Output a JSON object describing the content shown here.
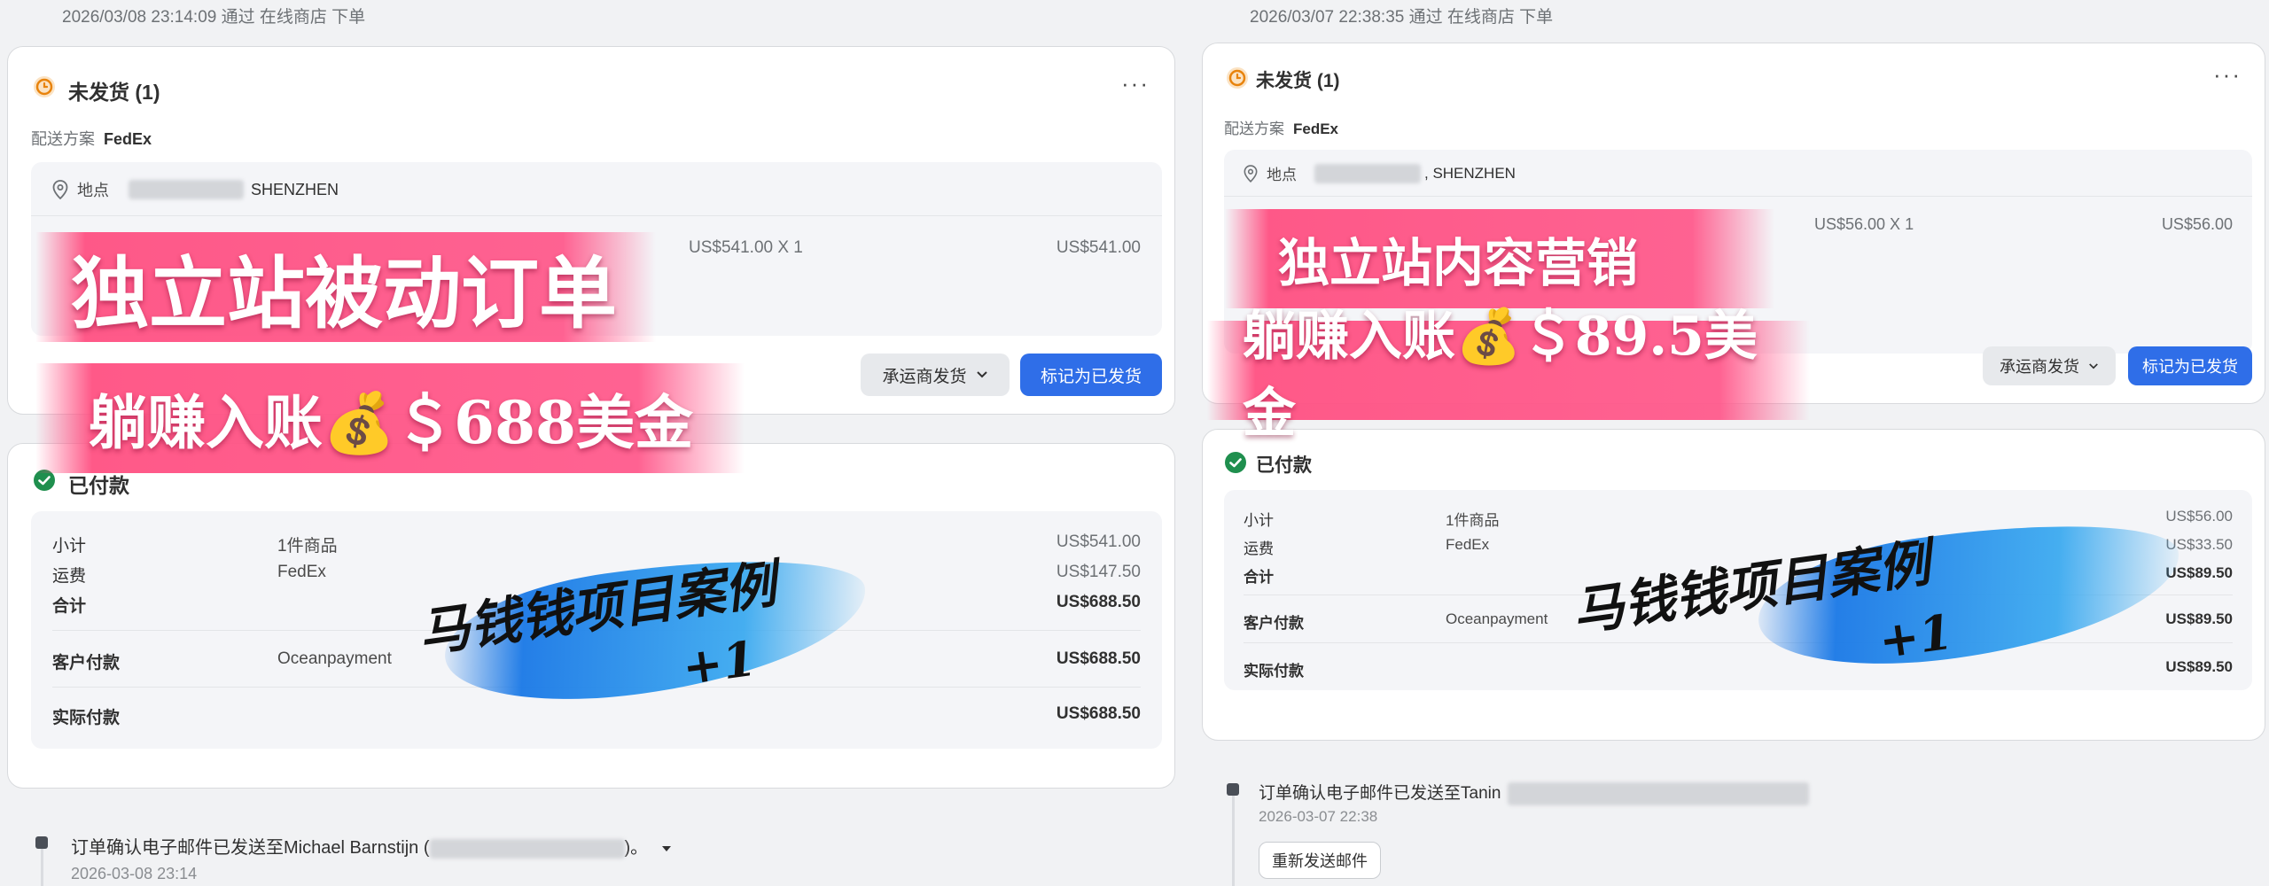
{
  "left": {
    "header": "2026/03/08 23:14:09 通过 在线商店 下单",
    "fulfill": {
      "title": "未发货 (1)",
      "ship_label": "配送方案",
      "ship_value": "FedEx",
      "loc_label": "地点",
      "loc_value": "SHENZHEN",
      "item_price": "US$541.00 X 1",
      "item_total": "US$541.00",
      "carrier_btn": "承运商发货",
      "mark_btn": "标记为已发货"
    },
    "paid": {
      "title": "已付款",
      "rows": [
        {
          "label": "小计",
          "mid": "1件商品",
          "value": "US$541.00"
        },
        {
          "label": "运费",
          "mid": "FedEx",
          "value": "US$147.50"
        },
        {
          "label": "合计",
          "mid": "",
          "value": "US$688.50"
        },
        {
          "label": "客户付款",
          "mid": "Oceanpayment",
          "value": "US$688.50"
        },
        {
          "label": "实际付款",
          "mid": "",
          "value": "US$688.50"
        }
      ]
    },
    "timeline": {
      "text": "订单确认电子邮件已发送至Michael Barnstijn (",
      "suffix": ")。",
      "time": "2026-03-08 23:14"
    },
    "overlay": {
      "banner1": "独立站被动订单",
      "banner2": "躺赚入账💰＄688美金",
      "brush_line1": "马钱钱项目案例",
      "brush_line2": "+1"
    }
  },
  "right": {
    "header": "2026/03/07 22:38:35 通过 在线商店 下单",
    "fulfill": {
      "title": "未发货 (1)",
      "ship_label": "配送方案",
      "ship_value": "FedEx",
      "loc_label": "地点",
      "loc_value": ", SHENZHEN",
      "item_price": "US$56.00 X 1",
      "item_total": "US$56.00",
      "carrier_btn": "承运商发货",
      "mark_btn": "标记为已发货"
    },
    "paid": {
      "title": "已付款",
      "rows": [
        {
          "label": "小计",
          "mid": "1件商品",
          "value": "US$56.00"
        },
        {
          "label": "运费",
          "mid": "FedEx",
          "value": "US$33.50"
        },
        {
          "label": "合计",
          "mid": "",
          "value": "US$89.50"
        },
        {
          "label": "客户付款",
          "mid": "Oceanpayment",
          "value": "US$89.50"
        },
        {
          "label": "实际付款",
          "mid": "",
          "value": "US$89.50"
        }
      ]
    },
    "timeline": {
      "text": "订单确认电子邮件已发送至Tanin",
      "time": "2026-03-07 22:38",
      "resend_btn": "重新发送邮件"
    },
    "overlay": {
      "banner1": "独立站内容营销",
      "banner2": "躺赚入账💰＄89.5美金",
      "brush_line1": "马钱钱项目案例",
      "brush_line2": "+1"
    }
  },
  "icons": {
    "unfulfilled": "clock-circle-icon",
    "paid": "check-circle-icon",
    "location": "location-pin-icon",
    "more": "more-horizontal-icon",
    "chevron": "chevron-down-icon",
    "dropdown": "caret-down-icon"
  },
  "colors": {
    "unfulfilled_icon": "#e8830c",
    "paid_icon": "#1f8f4e",
    "primary_button": "#2f6ee8",
    "banner_pink": "#ff5a8c",
    "brush_blue": "#2a8be6"
  }
}
